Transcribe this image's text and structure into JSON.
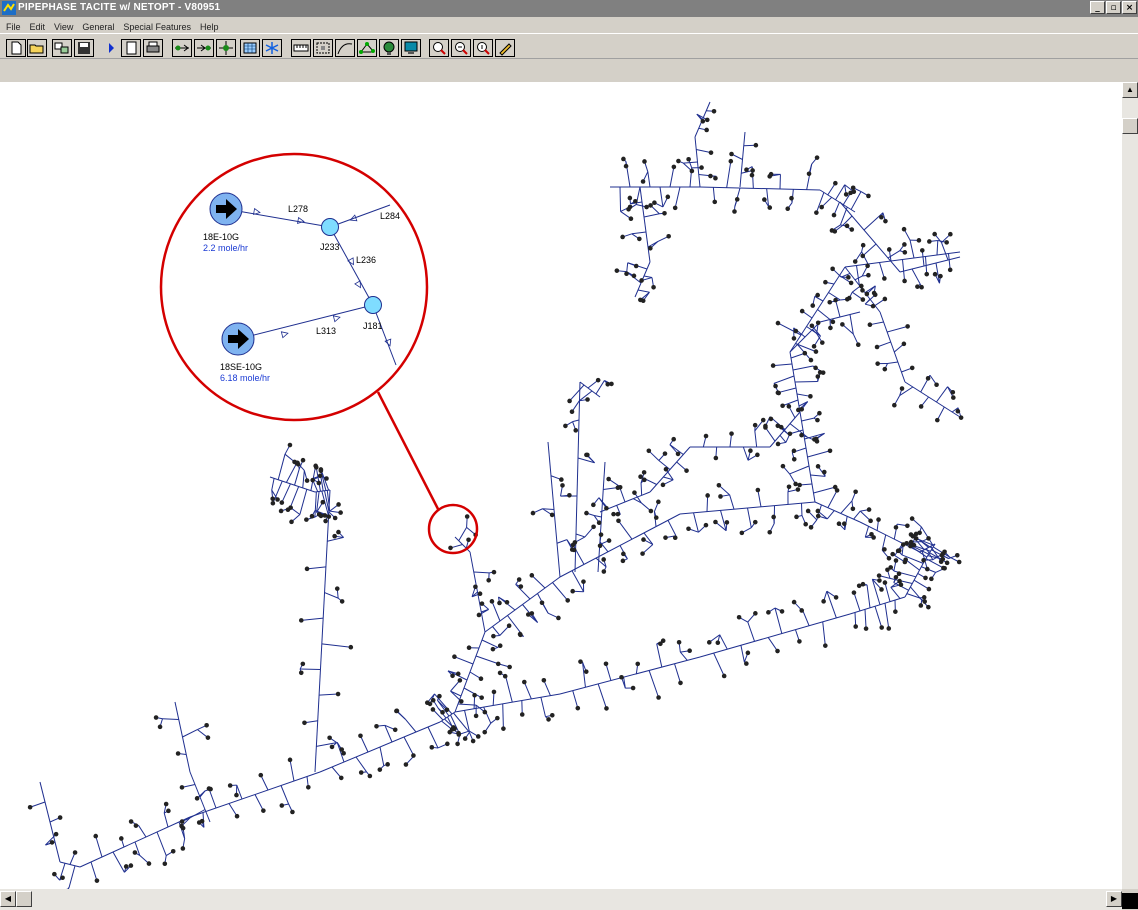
{
  "window": {
    "title": "PIPEPHASE TACITE w/ NETOPT - V80951",
    "controls": {
      "minimize": "_",
      "maximize": "▫",
      "close": "×"
    }
  },
  "menu": {
    "items": [
      "File",
      "Edit",
      "View",
      "General",
      "Special Features",
      "Help"
    ]
  },
  "toolbar": {
    "buttons": [
      "new-file-icon",
      "open-folder-icon",
      "import-icon",
      "save-icon",
      "run-icon",
      "page-icon",
      "print-icon",
      "source-node-icon",
      "sink-node-icon",
      "junction-node-icon",
      "grid-icon",
      "snowflake-icon",
      "ruler-icon",
      "fit-view-icon",
      "curve-icon",
      "network-icon",
      "globe-icon",
      "monitor-icon",
      "zoom-in-icon",
      "zoom-area-icon",
      "zoom-out-icon",
      "pencil-icon"
    ]
  },
  "inset": {
    "sources": [
      {
        "name": "18E-10G",
        "rate": "2.2 mole/hr"
      },
      {
        "name": "18SE-10G",
        "rate": "6.18 mole/hr"
      }
    ],
    "junctions": [
      "J233",
      "J181"
    ],
    "links": [
      "L278",
      "L284",
      "L236",
      "L313"
    ]
  },
  "colors": {
    "pipe": "#1f2f8f",
    "node": "#222222",
    "highlight": "#d40000",
    "junction_fill": "#7fdcff",
    "source_fill": "#7fb3f0",
    "rate_text": "#1a3ad4",
    "titlebar": "#808080",
    "chrome": "#d4d0c8"
  }
}
